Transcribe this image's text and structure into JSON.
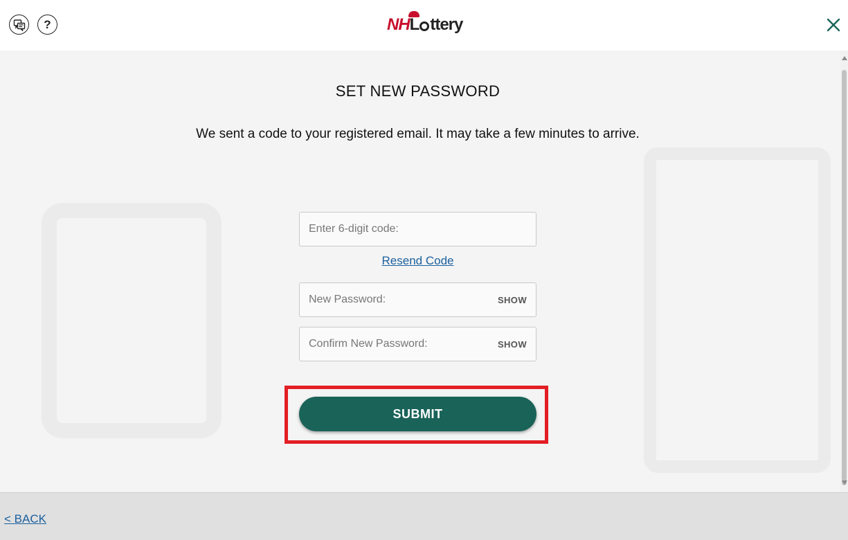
{
  "header": {
    "chat_icon": "chat-bubbles-icon",
    "help_label": "?",
    "logo_nh": "NH",
    "logo_lottery": "ttery",
    "close_icon": "close-icon"
  },
  "main": {
    "title": "SET NEW PASSWORD",
    "subtitle": "We sent a code to your registered email. It may take a few minutes to arrive.",
    "code_field": {
      "placeholder": "Enter 6-digit code:",
      "value": ""
    },
    "resend_label": "Resend Code",
    "new_password_field": {
      "placeholder": "New Password:",
      "value": "",
      "toggle_label": "SHOW"
    },
    "confirm_password_field": {
      "placeholder": "Confirm New Password:",
      "value": "",
      "toggle_label": "SHOW"
    },
    "submit_label": "SUBMIT"
  },
  "footer": {
    "back_label": "< BACK"
  },
  "colors": {
    "brand_green": "#1a6358",
    "highlight_red": "#e31e24",
    "link_blue": "#1a5f9e",
    "logo_red": "#c8102e"
  }
}
